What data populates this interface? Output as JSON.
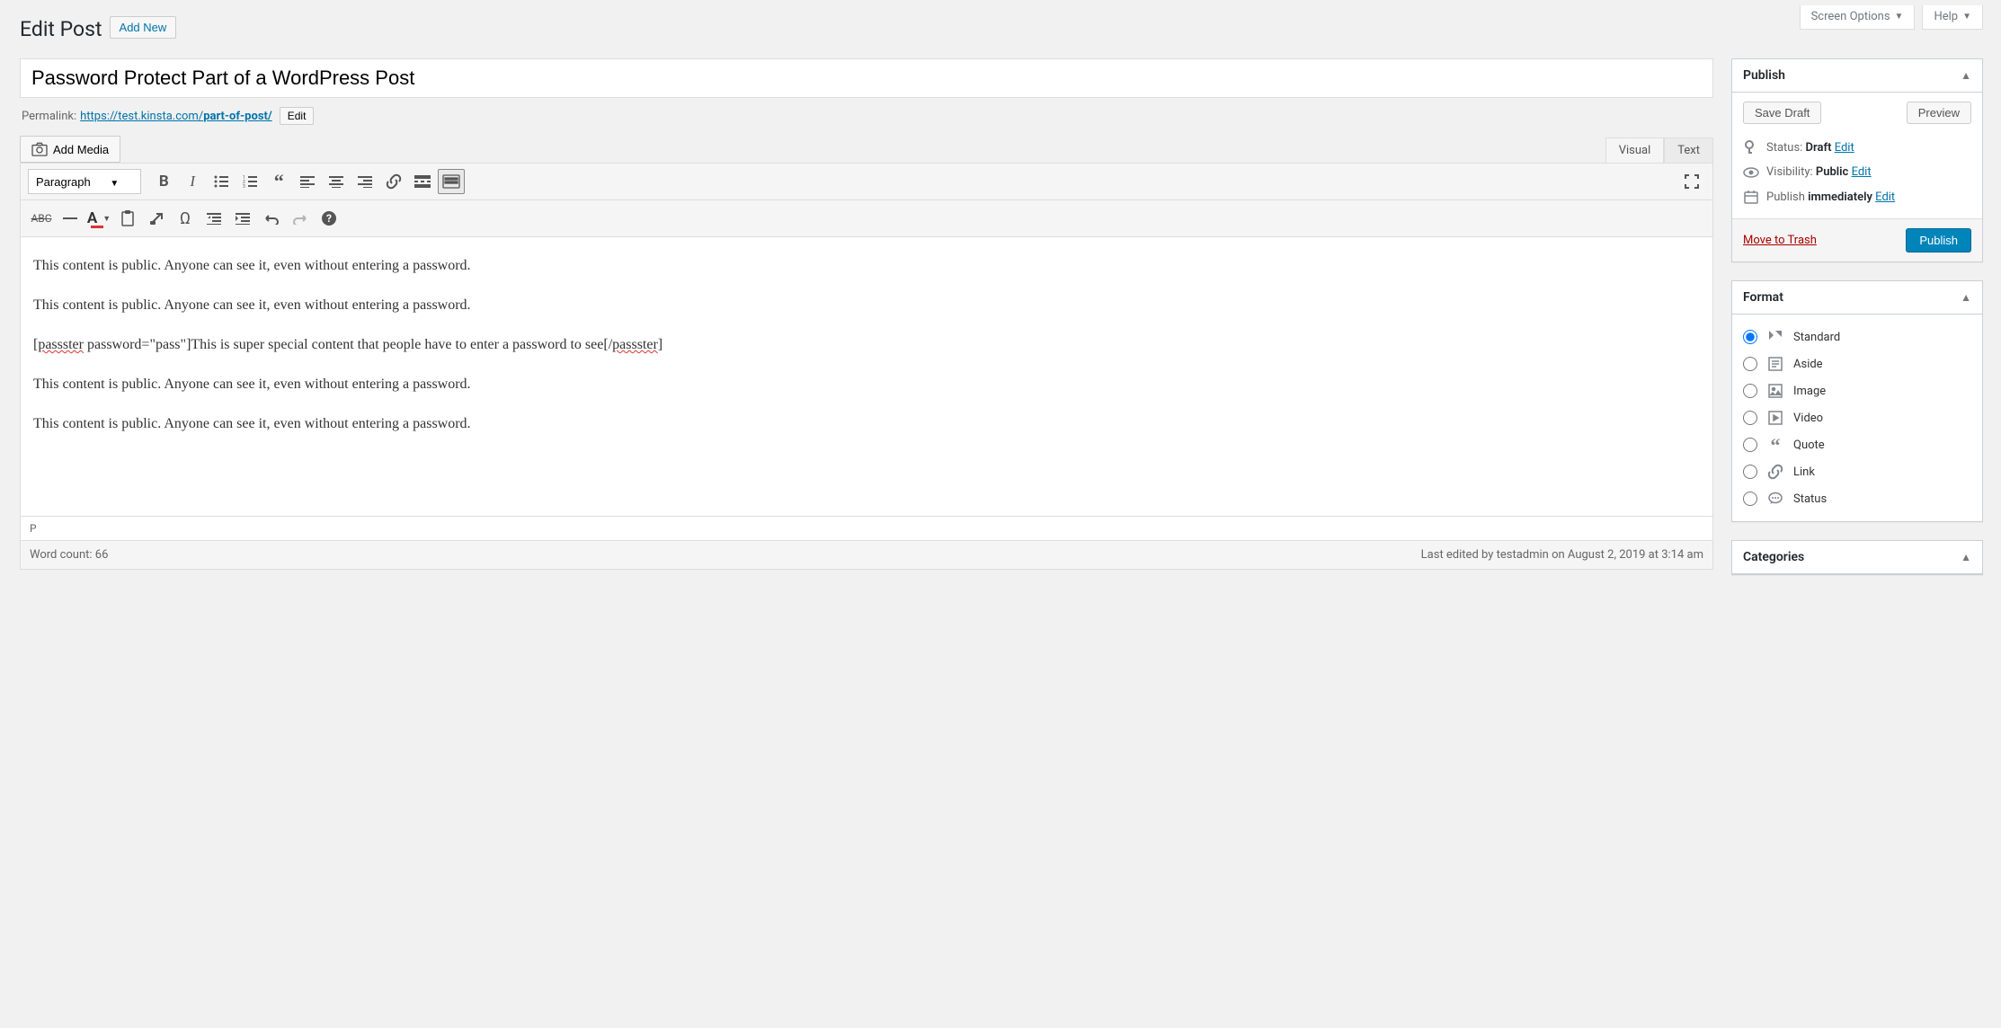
{
  "top_tabs": {
    "screen_options": "Screen Options",
    "help": "Help"
  },
  "header": {
    "page_title": "Edit Post",
    "add_new": "Add New"
  },
  "post": {
    "title": "Password Protect Part of a WordPress Post",
    "permalink_label": "Permalink:",
    "permalink_base": "https://test.kinsta.com/",
    "permalink_slug": "part-of-post/",
    "edit_slug": "Edit"
  },
  "media": {
    "add_media": "Add Media"
  },
  "editor": {
    "tabs": {
      "visual": "Visual",
      "text": "Text"
    },
    "format_select": "Paragraph",
    "content": {
      "p1": "This content is public. Anyone can see it, even without entering a password.",
      "p2": "This content is public. Anyone can see it, even without entering a password.",
      "p3_pre": "[",
      "p3_tag1": "passster",
      "p3_mid": " password=\"pass\"]This is super special content that people have to enter a password to see[/",
      "p3_tag2": "passster",
      "p3_post": "]",
      "p4": "This content is public. Anyone can see it, even without entering a password.",
      "p5": "This content is public. Anyone can see it, even without entering a password."
    },
    "status_path": "P",
    "word_count_label": "Word count: ",
    "word_count": "66",
    "last_edited": "Last edited by testadmin on August 2, 2019 at 3:14 am"
  },
  "publish": {
    "title": "Publish",
    "save_draft": "Save Draft",
    "preview": "Preview",
    "status_label": "Status: ",
    "status_value": "Draft",
    "visibility_label": "Visibility: ",
    "visibility_value": "Public",
    "publish_label": "Publish ",
    "publish_value": "immediately",
    "edit_link": "Edit",
    "trash": "Move to Trash",
    "publish_btn": "Publish"
  },
  "format": {
    "title": "Format",
    "items": [
      {
        "label": "Standard",
        "checked": true
      },
      {
        "label": "Aside",
        "checked": false
      },
      {
        "label": "Image",
        "checked": false
      },
      {
        "label": "Video",
        "checked": false
      },
      {
        "label": "Quote",
        "checked": false
      },
      {
        "label": "Link",
        "checked": false
      },
      {
        "label": "Status",
        "checked": false
      }
    ]
  },
  "categories": {
    "title": "Categories"
  }
}
